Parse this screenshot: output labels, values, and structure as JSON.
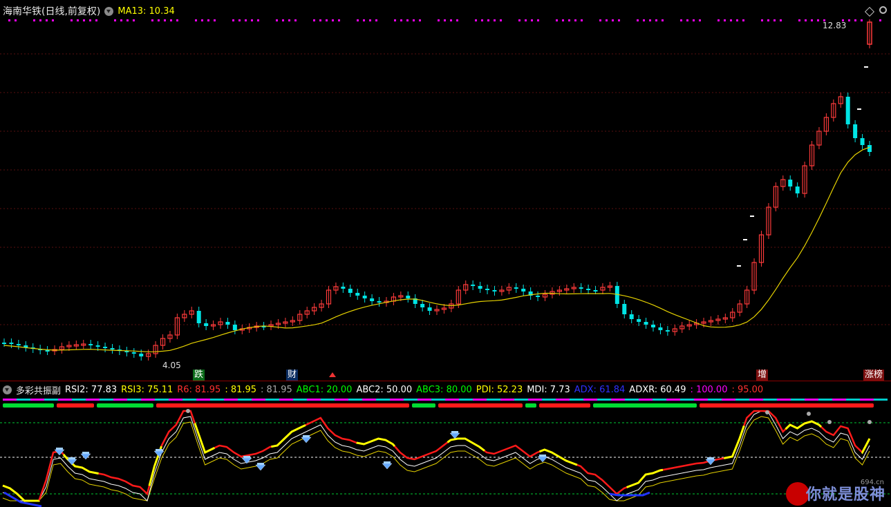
{
  "header": {
    "title": "海南华铁(日线,前复权)",
    "ma_label": "MA13: 10.34"
  },
  "price_labels": {
    "high": "12.83",
    "low": "4.05"
  },
  "event_tags": {
    "tag1": "跌",
    "tag2": "财",
    "tag3": "增",
    "tag4": "涨榜"
  },
  "indicator": {
    "name": "多彩共振副",
    "items": [
      {
        "text": "RSI2: 77.83",
        "color": "#ffffff"
      },
      {
        "text": "RSI3: 75.11",
        "color": "#ffff00"
      },
      {
        "text": "R6: 81.95",
        "color": "#ff3030"
      },
      {
        "text": ": 81.95",
        "color": "#ffff00"
      },
      {
        "text": ": 81.95",
        "color": "#aaaaaa"
      },
      {
        "text": "ABC1: 20.00",
        "color": "#00ff00"
      },
      {
        "text": "ABC2: 50.00",
        "color": "#ffffff"
      },
      {
        "text": "ABC3: 80.00",
        "color": "#00ff00"
      },
      {
        "text": "PDI: 52.23",
        "color": "#ffff00"
      },
      {
        "text": "MDI: 7.73",
        "color": "#ffffff"
      },
      {
        "text": "ADX: 61.84",
        "color": "#3030ff"
      },
      {
        "text": "ADXR: 60.49",
        "color": "#ffffff"
      },
      {
        "text": ": 100.00",
        "color": "#ff00ff"
      },
      {
        "text": ": 95.00",
        "color": "#ff3030"
      }
    ]
  },
  "watermark": {
    "url": "694.cn",
    "text": "你就是股神"
  },
  "colors": {
    "up": "#ff3b3b",
    "down": "#00e5e5",
    "ma": "#e6d200",
    "magenta": "#ff00ff"
  },
  "chart_data": {
    "type": "candlestick",
    "series": [
      {
        "name": "MA13",
        "last": 10.34
      }
    ],
    "visible_high": 12.83,
    "visible_low": 4.05
  }
}
